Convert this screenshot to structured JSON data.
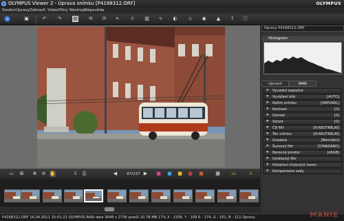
{
  "window": {
    "title": "OLYMPUS Viewer 2 - Úprava snímku [P4168312.ORF]",
    "brand": "OLYMPUS"
  },
  "menu": [
    "Soubor",
    "Úpravy",
    "Zobrazit",
    "Video",
    "Filtry",
    "Nástroje",
    "Nápověda"
  ],
  "toolbar_icons": [
    "home-icon",
    "save-icon",
    "undo-icon",
    "redo-icon",
    "compare-icon",
    "rotate-left-icon",
    "rotate-right-icon",
    "crop-icon",
    "adjust-icon",
    "levels-icon",
    "curves-icon",
    "color-icon",
    "sharpen-icon",
    "redeye-icon",
    "stamp-icon",
    "help-icon",
    "info-icon"
  ],
  "panel": {
    "file_tab": "Úpravy P4168312.ORF",
    "histogram_label": "Histogram",
    "tabs": [
      "Upravit",
      "RAW"
    ],
    "rows": [
      {
        "label": "Vyvolání expozice",
        "value": ""
      },
      {
        "label": "Vyvážení bílé",
        "value": "[AUTO]"
      },
      {
        "label": "Režim snímku",
        "value": "[NATURAL]"
      },
      {
        "label": "Kontrast",
        "value": "[0]"
      },
      {
        "label": "Ostrost",
        "value": "[0]"
      },
      {
        "label": "Sytost",
        "value": "[0]"
      },
      {
        "label": "ČB filtr",
        "value": "[N:NEUTRÁLNÍ]"
      },
      {
        "label": "Tón snímku",
        "value": "[N:NEUTRÁLNÍ]"
      },
      {
        "label": "Gradace",
        "value": "[Normální]"
      },
      {
        "label": "Šumový filtr",
        "value": "[STANDARD]"
      },
      {
        "label": "Barevný prostor",
        "value": "[sRGB]"
      },
      {
        "label": "Umělecký filtr",
        "value": ""
      },
      {
        "label": "Potlačení chybných barev",
        "value": ""
      },
      {
        "label": "Kompenzace vady",
        "value": ""
      }
    ]
  },
  "counter": "97/237",
  "status": "P4168312.ORF  16.04.2011  15:01:21  OLYMPUS RAW data  3648 x 2736 pixelů  10.78 MB  17%  X : 2336, Y : 109  R : 174, G : 152, B : 111  Úpravy",
  "watermark": "MANIE",
  "colors": {
    "accent": "#3a7bd5",
    "bus_red": "#b23a1c",
    "brick": "#8b4b36"
  }
}
